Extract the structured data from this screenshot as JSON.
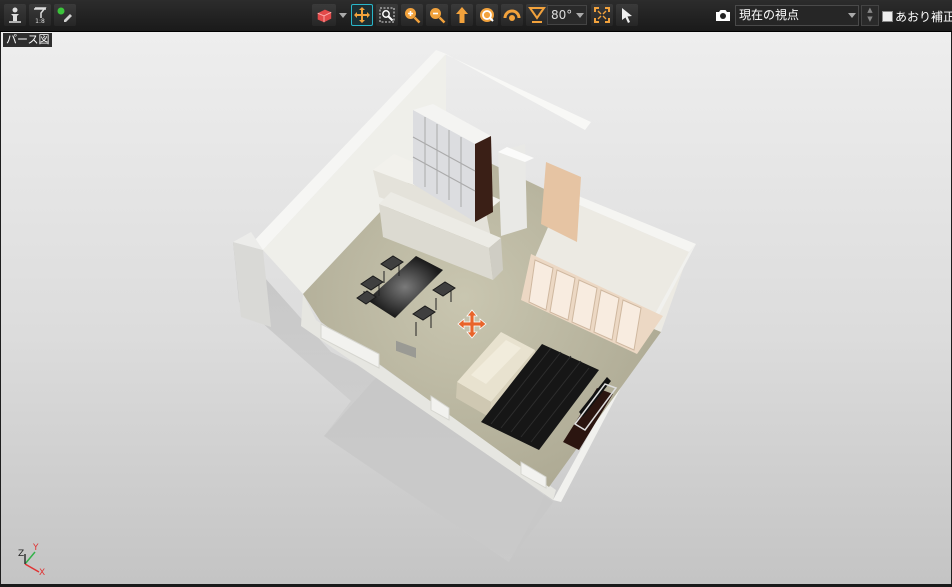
{
  "toolbar": {
    "left_icons": [
      "walker-icon",
      "walker-settings-icon",
      "light-pen-icon"
    ],
    "center_icons": [
      "render-cube-icon",
      "pan-move-icon",
      "zoom-window-icon",
      "zoom-in-icon",
      "zoom-out-icon",
      "move-forward-icon",
      "rotate-icon",
      "orbit-icon",
      "field-of-view-icon",
      "fit-all-icon",
      "select-pointer-icon"
    ],
    "fov_value": "80°",
    "camera_icon": "camera-icon",
    "view_select_value": "現在の視点",
    "tilt_correction_label": "あおり補正",
    "tilt_correction_checked": false
  },
  "viewport": {
    "label": "パース図",
    "axis_labels": {
      "x": "X",
      "y": "Y",
      "z": "Z"
    },
    "move_gizmo_icon": "move-cross-icon"
  },
  "colors": {
    "toolbar_bg": "#1e1e1e",
    "active_border": "#29b6c9",
    "gizmo_orange": "#e8642b",
    "viewport_bg": "#e6e6e6"
  }
}
